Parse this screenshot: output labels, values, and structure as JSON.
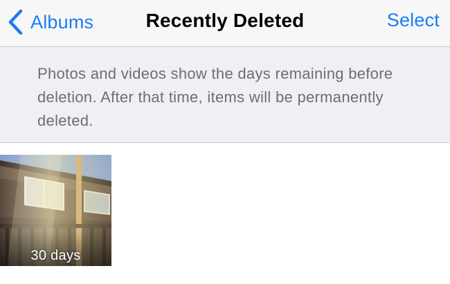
{
  "navbar": {
    "back_label": "Albums",
    "title": "Recently Deleted",
    "select_label": "Select"
  },
  "banner": {
    "text": "Photos and videos show the days remaining before deletion. After that time, items will be permanently deleted."
  },
  "photos": [
    {
      "days_label": "30 days"
    }
  ],
  "colors": {
    "accent": "#1a7cf5",
    "navbar_bg": "#f7f7f8",
    "banner_bg": "#efeff4",
    "banner_text": "#6d6d72"
  },
  "icons": {
    "back": "chevron-left-icon"
  }
}
